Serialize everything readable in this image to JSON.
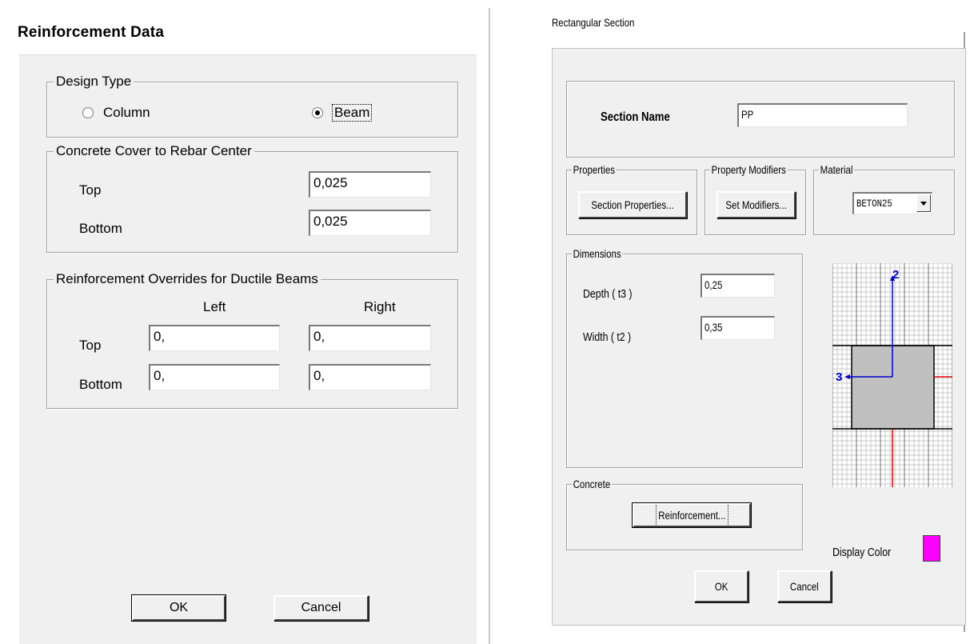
{
  "reinforcement_dialog": {
    "title": "Reinforcement Data",
    "design_type": {
      "legend": "Design Type",
      "column_label": "Column",
      "beam_label": "Beam",
      "selected": "Beam"
    },
    "cover": {
      "legend": "Concrete Cover to Rebar Center",
      "top_label": "Top",
      "top_value": "0,025",
      "bottom_label": "Bottom",
      "bottom_value": "0,025"
    },
    "overrides": {
      "legend": "Reinforcement Overrides for Ductile Beams",
      "left_header": "Left",
      "right_header": "Right",
      "top_label": "Top",
      "bottom_label": "Bottom",
      "top_left": "0,",
      "top_right": "0,",
      "bottom_left": "0,",
      "bottom_right": "0,"
    },
    "ok_label": "OK",
    "cancel_label": "Cancel"
  },
  "section_dialog": {
    "title": "Rectangular Section",
    "section_name_label": "Section Name",
    "section_name_value": "PP",
    "properties": {
      "legend": "Properties",
      "button_label": "Section Properties..."
    },
    "modifiers": {
      "legend": "Property Modifiers",
      "button_label": "Set Modifiers..."
    },
    "material": {
      "legend": "Material",
      "selected": "BETON25"
    },
    "dimensions": {
      "legend": "Dimensions",
      "depth_label": "Depth ( t3 )",
      "depth_value": "0,25",
      "width_label": "Width ( t2 )",
      "width_value": "0,35"
    },
    "concrete": {
      "legend": "Concrete",
      "button_label": "Reinforcement..."
    },
    "preview": {
      "axis_2_label": "2",
      "axis_3_label": "3"
    },
    "display_color_label": "Display Color",
    "display_color": "#ff00ff",
    "ok_label": "OK",
    "cancel_label": "Cancel"
  }
}
